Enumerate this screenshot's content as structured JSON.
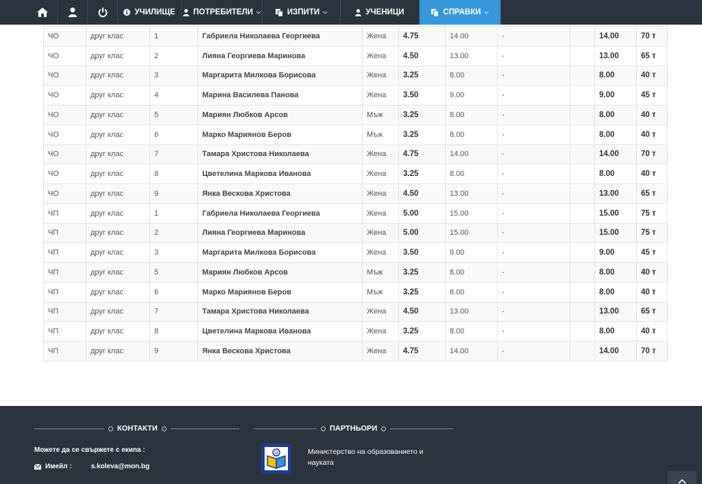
{
  "nav": {
    "home_icon": "home-icon",
    "user_icon": "user-icon",
    "power_icon": "power-icon",
    "items": [
      {
        "label": "УЧИЛИЩЕ",
        "icon": "info-icon",
        "has_caret": false
      },
      {
        "label": "ПОТРЕБИТЕЛИ",
        "icon": "user-icon",
        "has_caret": true
      },
      {
        "label": "ИЗПИТИ",
        "icon": "copy-icon",
        "has_caret": true
      },
      {
        "label": "УЧЕНИЦИ",
        "icon": "user-icon",
        "has_caret": false
      },
      {
        "label": "СПРАВКИ",
        "icon": "copy-icon",
        "has_caret": true,
        "active": true
      }
    ],
    "active_color": "#3498db",
    "bar_color": "#2b333e"
  },
  "table": {
    "rows": [
      [
        "ЧО",
        "друг клас",
        "1",
        "Габриела Николаева Георгиева",
        "Жена",
        "4.75",
        "14.00",
        "-",
        "",
        "14.00",
        "70 т"
      ],
      [
        "ЧО",
        "друг клас",
        "2",
        "Лияна Георгиева Маринова",
        "Жена",
        "4.50",
        "13.00",
        "-",
        "",
        "13.00",
        "65 т"
      ],
      [
        "ЧО",
        "друг клас",
        "3",
        "Маргарита Милкова Борисова",
        "Жена",
        "3.25",
        "8.00",
        "-",
        "",
        "8.00",
        "40 т"
      ],
      [
        "ЧО",
        "друг клас",
        "4",
        "Марина Василева Панова",
        "Жена",
        "3.50",
        "9.00",
        "-",
        "",
        "9.00",
        "45 т"
      ],
      [
        "ЧО",
        "друг клас",
        "5",
        "Мариян Любков Арсов",
        "Мъж",
        "3.25",
        "8.00",
        "-",
        "",
        "8.00",
        "40 т"
      ],
      [
        "ЧО",
        "друг клас",
        "6",
        "Марко Мариянов Беров",
        "Мъж",
        "3.25",
        "8.00",
        "-",
        "",
        "8.00",
        "40 т"
      ],
      [
        "ЧО",
        "друг клас",
        "7",
        "Тамара Христова Николаева",
        "Жена",
        "4.75",
        "14.00",
        "-",
        "",
        "14.00",
        "70 т"
      ],
      [
        "ЧО",
        "друг клас",
        "8",
        "Цветелина Маркова Иванова",
        "Жена",
        "3.25",
        "8.00",
        "-",
        "",
        "8.00",
        "40 т"
      ],
      [
        "ЧО",
        "друг клас",
        "9",
        "Янка Вескова Христова",
        "Жена",
        "4.50",
        "13.00",
        "-",
        "",
        "13.00",
        "65 т"
      ],
      [
        "ЧП",
        "друг клас",
        "1",
        "Габриела Николаева Георгиева",
        "Жена",
        "5.00",
        "15.00",
        "-",
        "",
        "15.00",
        "75 т"
      ],
      [
        "ЧП",
        "друг клас",
        "2",
        "Лияна Георгиева Маринова",
        "Жена",
        "5.00",
        "15.00",
        "-",
        "",
        "15.00",
        "75 т"
      ],
      [
        "ЧП",
        "друг клас",
        "3",
        "Маргарита Милкова Борисова",
        "Жена",
        "3.50",
        "9.00",
        "-",
        "",
        "9.00",
        "45 т"
      ],
      [
        "ЧП",
        "друг клас",
        "5",
        "Мариян Любков Арсов",
        "Мъж",
        "3.25",
        "8.00",
        "-",
        "",
        "8.00",
        "40 т"
      ],
      [
        "ЧП",
        "друг клас",
        "6",
        "Марко Мариянов Беров",
        "Мъж",
        "3.25",
        "8.00",
        "-",
        "",
        "8.00",
        "40 т"
      ],
      [
        "ЧП",
        "друг клас",
        "7",
        "Тамара Христова Николаева",
        "Жена",
        "4.50",
        "13.00",
        "-",
        "",
        "13.00",
        "65 т"
      ],
      [
        "ЧП",
        "друг клас",
        "8",
        "Цветелина Маркова Иванова",
        "Жена",
        "3.25",
        "8.00",
        "-",
        "",
        "8.00",
        "40 т"
      ],
      [
        "ЧП",
        "друг клас",
        "9",
        "Янка Вескова Христова",
        "Жена",
        "4.75",
        "14.00",
        "-",
        "",
        "14.00",
        "70 т"
      ]
    ]
  },
  "footer": {
    "contacts_title": "КОНТАКТИ",
    "contact_text": "Можете да се свържете с екипа :",
    "email_label": "Имейл :",
    "email_value": "s.koleva@mon.bg",
    "partners_title": "ПАРТНЬОРИ",
    "partner_name": "Министерство на образованието и науката",
    "bg_color": "#2b333e"
  }
}
